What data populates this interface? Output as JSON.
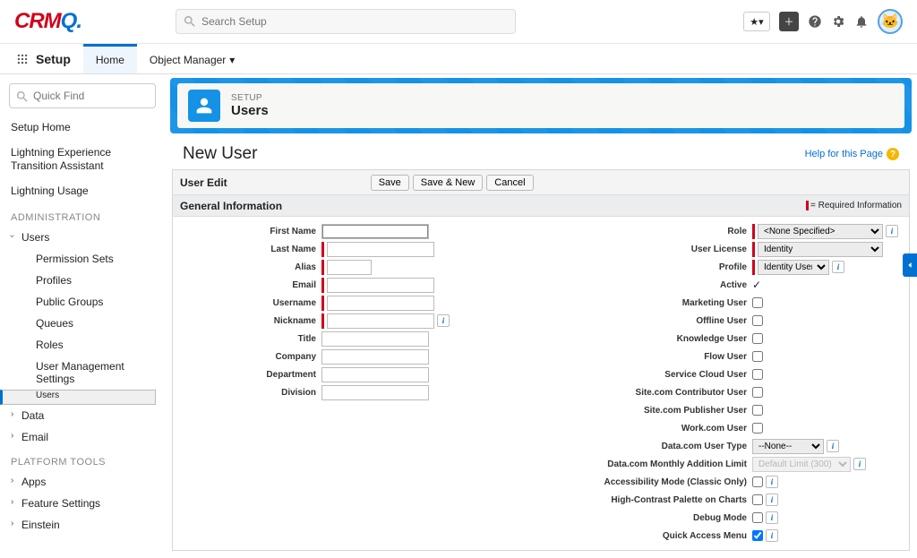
{
  "top": {
    "logo_text": "CRM",
    "logo_accent": "Q.",
    "search_placeholder": "Search Setup",
    "app_label": "Setup",
    "tabs": {
      "home": "Home",
      "om": "Object Manager"
    }
  },
  "sidebar": {
    "quickfind_placeholder": "Quick Find",
    "links": {
      "setup_home": "Setup Home",
      "transition": "Lightning Experience Transition Assistant",
      "usage": "Lightning Usage"
    },
    "section_admin": "ADMINISTRATION",
    "users_group": "Users",
    "users_children": {
      "perm": "Permission Sets",
      "profiles": "Profiles",
      "pg": "Public Groups",
      "queues": "Queues",
      "roles": "Roles",
      "ums": "User Management Settings",
      "users": "Users"
    },
    "data": "Data",
    "email": "Email",
    "section_platform": "PLATFORM TOOLS",
    "apps": "Apps",
    "feature": "Feature Settings",
    "einstein": "Einstein"
  },
  "hero": {
    "kicker": "SETUP",
    "title": "Users"
  },
  "page": {
    "title": "New User",
    "help": "Help for this Page"
  },
  "form": {
    "bar_title": "User Edit",
    "btn_save": "Save",
    "btn_save_new": "Save & New",
    "btn_cancel": "Cancel",
    "section": "General Information",
    "req_label": "= Required Information"
  },
  "left_fields": {
    "first_name": "First Name",
    "last_name": "Last Name",
    "alias": "Alias",
    "email": "Email",
    "username": "Username",
    "nickname": "Nickname",
    "title": "Title",
    "company": "Company",
    "department": "Department",
    "division": "Division"
  },
  "right_fields": {
    "role": "Role",
    "role_val": "<None Specified>",
    "user_license": "User License",
    "user_license_val": "Identity",
    "profile": "Profile",
    "profile_val": "Identity User",
    "active": "Active",
    "marketing": "Marketing User",
    "offline": "Offline User",
    "knowledge": "Knowledge User",
    "flow": "Flow User",
    "service_cloud": "Service Cloud User",
    "site_contrib": "Site.com Contributor User",
    "site_pub": "Site.com Publisher User",
    "work": "Work.com User",
    "datacom_type": "Data.com User Type",
    "datacom_type_val": "--None--",
    "datacom_limit": "Data.com Monthly Addition Limit",
    "datacom_limit_val": "Default Limit (300)",
    "accessibility": "Accessibility Mode (Classic Only)",
    "contrast": "High-Contrast Palette on Charts",
    "debug": "Debug Mode",
    "quick_access": "Quick Access Menu"
  }
}
